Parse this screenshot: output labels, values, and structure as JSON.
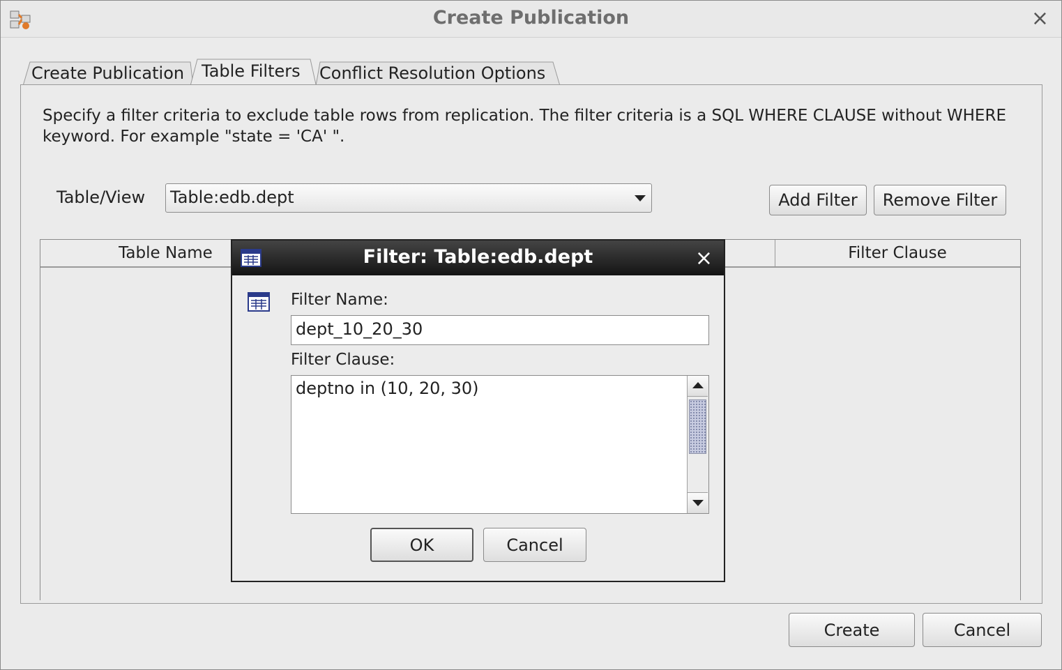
{
  "window": {
    "title": "Create Publication",
    "close_glyph": "×",
    "icon": "replication-app-icon"
  },
  "tabs": [
    {
      "label": "Create Publication",
      "selected": false
    },
    {
      "label": "Table Filters",
      "selected": true
    },
    {
      "label": "Conflict Resolution Options",
      "selected": false
    }
  ],
  "table_filters": {
    "description": "Specify a filter criteria to exclude table rows from replication. The filter criteria is a SQL WHERE CLAUSE without WHERE keyword. For example \"state = 'CA' \".",
    "table_view_label": "Table/View",
    "table_view_value": "Table:edb.dept",
    "add_filter_label": "Add Filter",
    "remove_filter_label": "Remove Filter",
    "columns": [
      "Table Name",
      "Filter Clause"
    ]
  },
  "footer": {
    "create_label": "Create",
    "cancel_label": "Cancel"
  },
  "filter_dialog": {
    "title": "Filter: Table:edb.dept",
    "close_glyph": "×",
    "name_label": "Filter Name:",
    "name_value": "dept_10_20_30",
    "clause_label": "Filter Clause:",
    "clause_value": "deptno in (10, 20, 30)",
    "ok_label": "OK",
    "cancel_label": "Cancel"
  }
}
